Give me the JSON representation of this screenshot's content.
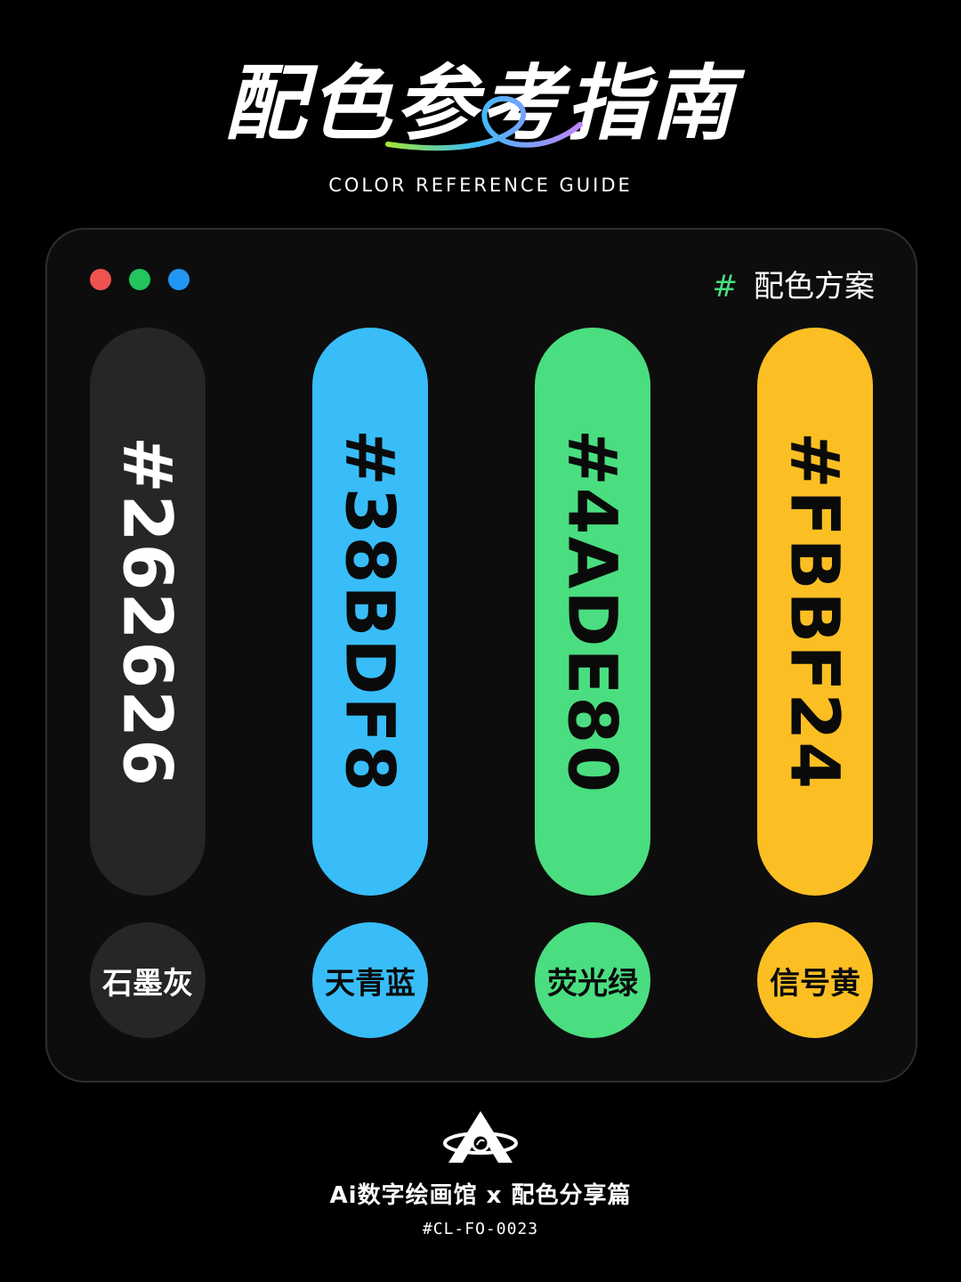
{
  "header": {
    "title": "配色参考指南",
    "subtitle": "COLOR REFERENCE GUIDE"
  },
  "panel": {
    "window_dots": [
      "#ef5350",
      "#22c55e",
      "#2196f3"
    ],
    "scheme_hash": "#",
    "scheme_label": "配色方案"
  },
  "swatches": [
    {
      "hex": "#262626",
      "name": "石墨灰",
      "color": "#262626",
      "text_color": "#ffffff"
    },
    {
      "hex": "#38BDF8",
      "name": "天青蓝",
      "color": "#38bdf8",
      "text_color": "#0a0a0a"
    },
    {
      "hex": "#4ADE80",
      "name": "荧光绿",
      "color": "#4ade80",
      "text_color": "#0a0a0a"
    },
    {
      "hex": "#FBBF24",
      "name": "信号黄",
      "color": "#fbbf24",
      "text_color": "#0a0a0a"
    }
  ],
  "footer": {
    "title": "Ai数字绘画馆 x 配色分享篇",
    "code": "#CL-FO-0023"
  }
}
